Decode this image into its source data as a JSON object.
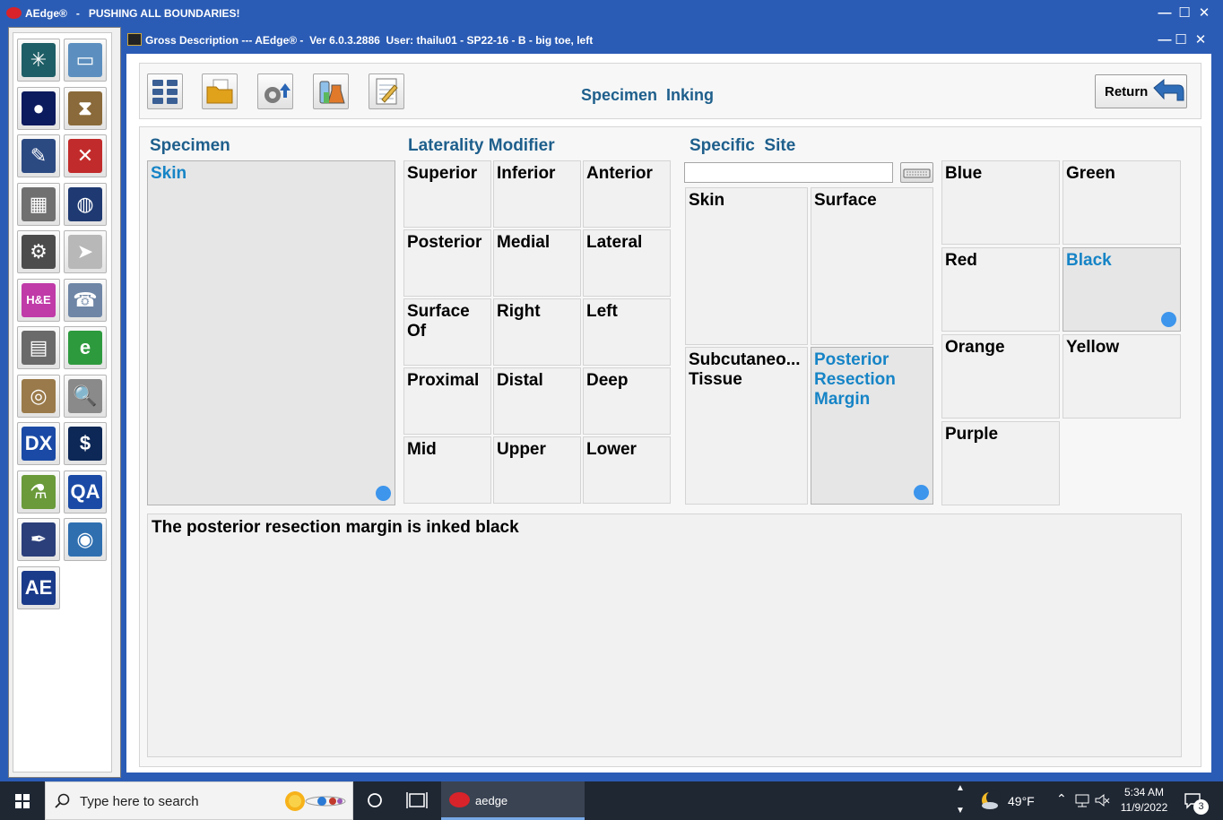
{
  "app_window": {
    "title": "AEdge®   -   PUSHING ALL BOUNDARIES!",
    "controls": {
      "minimize": "—",
      "maximize": "☐",
      "close": "✕"
    }
  },
  "child_window": {
    "title": "Gross Description --- AEdge® -  Ver 6.0.3.2886  User: thailu01 - SP22-16 - B - big toe, left",
    "controls": {
      "minimize": "—",
      "maximize": "☐",
      "close": "✕"
    }
  },
  "left_toolbar": {
    "tools": [
      {
        "name": "cassette-icon",
        "glyph": "✳",
        "bg": "#1e5e66"
      },
      {
        "name": "computer-icon",
        "glyph": "▭",
        "bg": "#5c8fbf"
      },
      {
        "name": "specimen-jar-icon",
        "glyph": "●",
        "bg": "#0c1a5e"
      },
      {
        "name": "hourglass-icon",
        "glyph": "⧗",
        "bg": "#8a6a3a"
      },
      {
        "name": "ink-jar-icon",
        "glyph": "✎",
        "bg": "#2c4a82"
      },
      {
        "name": "tools-icon",
        "glyph": "✕",
        "bg": "#c22b2b"
      },
      {
        "name": "printer-machine-icon",
        "glyph": "▦",
        "bg": "#707070"
      },
      {
        "name": "globe-grid-icon",
        "glyph": "◍",
        "bg": "#1f3a72"
      },
      {
        "name": "microtome-icon",
        "glyph": "⚙",
        "bg": "#4c4c4c"
      },
      {
        "name": "paper-plane-icon",
        "glyph": "➤",
        "bg": "#b8b8b8"
      },
      {
        "name": "he-stain-icon",
        "glyph": "H&E",
        "bg": "#c03aa8"
      },
      {
        "name": "fax-icon",
        "glyph": "☎",
        "bg": "#6f86a6"
      },
      {
        "name": "slides-icon",
        "glyph": "▤",
        "bg": "#6a6a6a"
      },
      {
        "name": "email-arrow-icon",
        "glyph": "e",
        "bg": "#2e9a3e"
      },
      {
        "name": "gross-exam-icon",
        "glyph": "◎",
        "bg": "#9a7a4a"
      },
      {
        "name": "magnifier-doc-icon",
        "glyph": "🔍",
        "bg": "#8a8a8a"
      },
      {
        "name": "dx-icon",
        "glyph": "DX",
        "bg": "#1a4aa5"
      },
      {
        "name": "billing-icon",
        "glyph": "$",
        "bg": "#0d2756"
      },
      {
        "name": "lab-flask-icon",
        "glyph": "⚗",
        "bg": "#6a9a3a"
      },
      {
        "name": "qa-icon",
        "glyph": "QA",
        "bg": "#1a4aa5"
      },
      {
        "name": "fountain-pen-icon",
        "glyph": "✒",
        "bg": "#2b3f7a"
      },
      {
        "name": "web-globe-icon",
        "glyph": "◉",
        "bg": "#2f6fb0"
      },
      {
        "name": "aedge-logo-icon",
        "glyph": "AE",
        "bg": "#1a3a8a"
      }
    ]
  },
  "toolbar": {
    "buttons": [
      {
        "name": "grid-view-button",
        "icon": "grid-icon"
      },
      {
        "name": "open-folder-button",
        "icon": "folder-icon"
      },
      {
        "name": "settings-upload-button",
        "icon": "gear-upload-icon"
      },
      {
        "name": "lab-button",
        "icon": "beaker-icon"
      },
      {
        "name": "notes-button",
        "icon": "notepad-icon"
      }
    ],
    "screen_title": "Specimen  Inking",
    "return_label": "Return"
  },
  "sections": {
    "specimen": "Specimen",
    "laterality": "Laterality Modifier",
    "specific_site": "Specific  Site"
  },
  "specimen_list": [
    {
      "label": "Skin",
      "selected": true
    }
  ],
  "laterality_modifiers": [
    {
      "label": "Superior"
    },
    {
      "label": "Inferior"
    },
    {
      "label": "Anterior"
    },
    {
      "label": "Posterior"
    },
    {
      "label": "Medial"
    },
    {
      "label": "Lateral"
    },
    {
      "label": "Surface\nOf"
    },
    {
      "label": "Right"
    },
    {
      "label": "Left"
    },
    {
      "label": "Proximal"
    },
    {
      "label": "Distal"
    },
    {
      "label": "Deep"
    },
    {
      "label": "Mid"
    },
    {
      "label": "Upper"
    },
    {
      "label": "Lower"
    }
  ],
  "site_search": {
    "value": "",
    "placeholder": ""
  },
  "specific_sites": [
    {
      "label": "Skin",
      "selected": false
    },
    {
      "label": "Surface",
      "selected": false
    },
    {
      "label": "Subcutaneo...\nTissue",
      "selected": false
    },
    {
      "label": "Posterior\nResection\nMargin",
      "selected": true
    }
  ],
  "ink_colors": [
    {
      "label": "Blue",
      "selected": false
    },
    {
      "label": "Green",
      "selected": false
    },
    {
      "label": "Red",
      "selected": false
    },
    {
      "label": "Black",
      "selected": true
    },
    {
      "label": "Orange",
      "selected": false
    },
    {
      "label": "Yellow",
      "selected": false
    },
    {
      "label": "Purple",
      "selected": false
    }
  ],
  "description_text": "The posterior resection margin is inked black",
  "taskbar": {
    "search_placeholder": "Type here to search",
    "active_app": "aedge",
    "weather": "49°F",
    "time": "5:34 AM",
    "date": "11/9/2022",
    "notification_count": "3"
  },
  "colors": {
    "title_bar": "#2b5cb5",
    "header_text": "#1e5f8c",
    "selected_text": "#1684c6",
    "selected_dot": "#3d95ec",
    "taskbar": "#1f2733"
  }
}
